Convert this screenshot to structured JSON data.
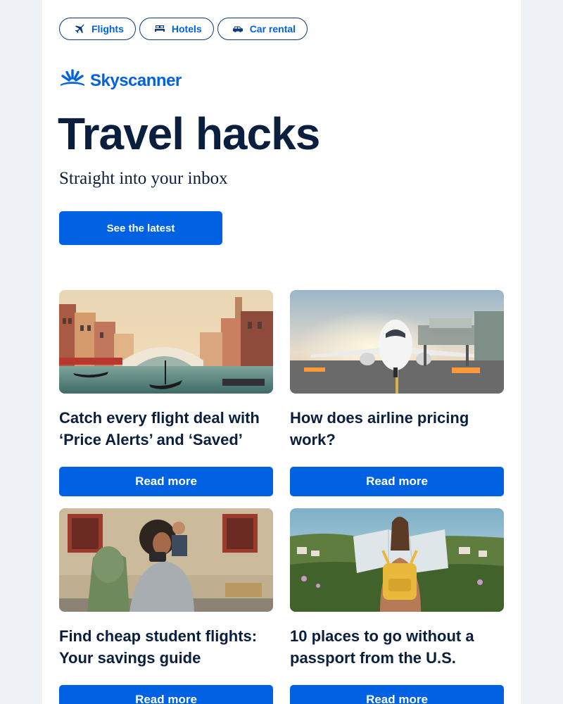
{
  "nav_pills": [
    {
      "label": "Flights",
      "icon": "plane-icon"
    },
    {
      "label": "Hotels",
      "icon": "bed-icon"
    },
    {
      "label": "Car rental",
      "icon": "car-icon"
    }
  ],
  "brand": {
    "name": "Skyscanner",
    "color": "#0062e3"
  },
  "hero": {
    "title": "Travel hacks",
    "subtitle": "Straight into your inbox",
    "cta_label": "See the latest"
  },
  "articles": [
    {
      "title": "Catch every flight deal with ‘Price Alerts’ and ‘Saved’",
      "button_label": "Read more"
    },
    {
      "title": "How does airline pricing work?",
      "button_label": "Read more"
    },
    {
      "title": "Find cheap student flights: Your savings guide",
      "button_label": "Read more"
    },
    {
      "title": "10 places to go without a passport from the U.S.",
      "button_label": "Read more"
    }
  ],
  "colors": {
    "accent": "#0062e3",
    "heading": "#0a1f3d",
    "background": "#eef1f6"
  }
}
